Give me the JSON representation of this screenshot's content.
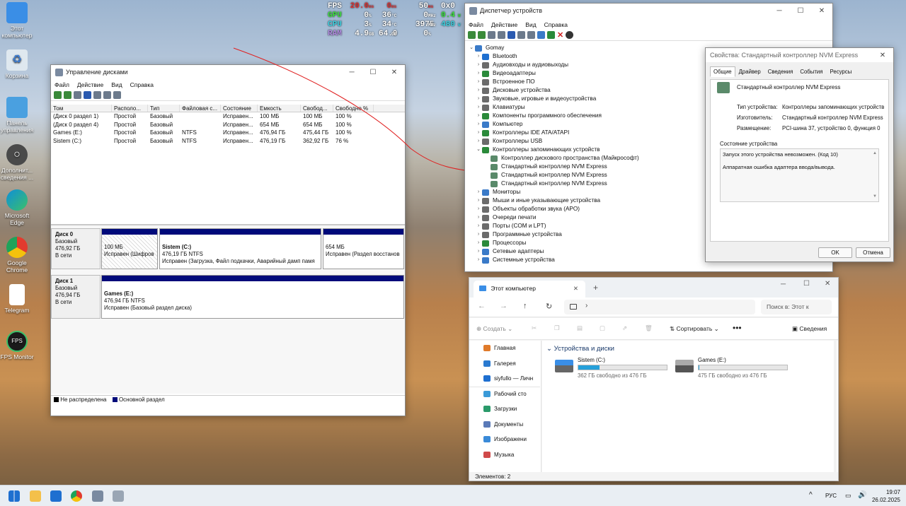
{
  "desktop": {
    "icons": [
      {
        "label": "Этот компьютер",
        "icon": "monitor-icon"
      },
      {
        "label": "Корзина",
        "icon": "recycle-bin-icon"
      },
      {
        "label": "Панель управления",
        "icon": "control-panel-icon"
      },
      {
        "label": "Дополнит... сведения ...",
        "icon": "settings-icon"
      },
      {
        "label": "Microsoft Edge",
        "icon": "edge-icon"
      },
      {
        "label": "Google Chrome",
        "icon": "chrome-icon"
      },
      {
        "label": "Telegram",
        "icon": "file-icon"
      },
      {
        "label": "FPS Monitor",
        "icon": "fps-monitor-icon"
      }
    ]
  },
  "overlay": {
    "fps": {
      "label": "FPS",
      "value": "20.0",
      "unit": "ms",
      "v2": "0",
      "u2": "ms",
      "v3": "50",
      "u3": "ms",
      "v4": "0x0"
    },
    "gpu": {
      "label": "GPU",
      "value": "0",
      "unit": "%",
      "v2": "36",
      "u2": "°C",
      "v3": "0",
      "u3": "MHz",
      "v4": "0.4",
      "u4": "W"
    },
    "cpu": {
      "label": "CPU",
      "value": "3",
      "unit": "%",
      "v2": "34",
      "u2": "°C",
      "v3": "3975",
      "u3": "MHz",
      "v4": "480",
      "u4": "W"
    },
    "ram": {
      "label": "RAM",
      "value": "4.9",
      "unit": "GB",
      "v2": "64.0",
      "u2": "GB",
      "v3": "0",
      "u3": "%"
    }
  },
  "disk_mgmt": {
    "title": "Управление дисками",
    "menu": [
      "Файл",
      "Действие",
      "Вид",
      "Справка"
    ],
    "columns": [
      "Том",
      "Располо...",
      "Тип",
      "Файловая с...",
      "Состояние",
      "Емкость",
      "Свобод...",
      "Свободно %"
    ],
    "rows": [
      [
        "(Диск 0 раздел 1)",
        "Простой",
        "Базовый",
        "",
        "Исправен...",
        "100 МБ",
        "100 МБ",
        "100 %"
      ],
      [
        "(Диск 0 раздел 4)",
        "Простой",
        "Базовый",
        "",
        "Исправен...",
        "654 МБ",
        "654 МБ",
        "100 %"
      ],
      [
        "Games (E:)",
        "Простой",
        "Базовый",
        "NTFS",
        "Исправен...",
        "476,94 ГБ",
        "475,44 ГБ",
        "100 %"
      ],
      [
        "Sistem (C:)",
        "Простой",
        "Базовый",
        "NTFS",
        "Исправен...",
        "476,19 ГБ",
        "362,92 ГБ",
        "76 %"
      ]
    ],
    "disk0": {
      "name": "Диск 0",
      "type": "Базовый",
      "size": "476,92 ГБ",
      "status": "В сети",
      "p1": {
        "size": "100 МБ",
        "status": "Исправен (Шифров"
      },
      "p2": {
        "name": "Sistem  (C:)",
        "size": "476,19 ГБ NTFS",
        "status": "Исправен (Загрузка, Файл подкачки, Аварийный дамп памя"
      },
      "p3": {
        "size": "654 МБ",
        "status": "Исправен (Раздел восстанов"
      }
    },
    "disk1": {
      "name": "Диск 1",
      "type": "Базовый",
      "size": "476,94 ГБ",
      "status": "В сети",
      "p1": {
        "name": "Games  (E:)",
        "size": "476,94 ГБ NTFS",
        "status": "Исправен (Базовый раздел диска)"
      }
    },
    "legend": {
      "unallocated": "Не распределена",
      "primary": "Основной раздел"
    }
  },
  "dev_mgr": {
    "title": "Диспетчер устройств",
    "menu": [
      "Файл",
      "Действие",
      "Вид",
      "Справка"
    ],
    "root": "Gomay",
    "items": [
      {
        "label": "Bluetooth",
        "color": "#1e6fd0"
      },
      {
        "label": "Аудиовходы и аудиовыходы",
        "color": "#6b6b6b"
      },
      {
        "label": "Видеоадаптеры",
        "color": "#2a8a3a"
      },
      {
        "label": "Встроенное ПО",
        "color": "#6b6b6b"
      },
      {
        "label": "Дисковые устройства",
        "color": "#6b6b6b"
      },
      {
        "label": "Звуковые, игровые и видеоустройства",
        "color": "#6b6b6b"
      },
      {
        "label": "Клавиатуры",
        "color": "#6b6b6b"
      },
      {
        "label": "Компоненты программного обеспечения",
        "color": "#2a8a3a"
      },
      {
        "label": "Компьютер",
        "color": "#3a7ac8"
      },
      {
        "label": "Контроллеры IDE ATA/ATAPI",
        "color": "#2a8a3a"
      },
      {
        "label": "Контроллеры USB",
        "color": "#6b6b6b"
      },
      {
        "label": "Контроллеры запоминающих устройств",
        "color": "#2a8a3a"
      }
    ],
    "storage_children": [
      "Контроллер дискового пространства (Майкрософт)",
      "Стандартный контроллер NVM Express",
      "Стандартный контроллер NVM Express",
      "Стандартный контроллер NVM Express"
    ],
    "items_after": [
      {
        "label": "Мониторы",
        "color": "#3a7ac8"
      },
      {
        "label": "Мыши и иные указывающие устройства",
        "color": "#6b6b6b"
      },
      {
        "label": "Объекты обработки звука (APO)",
        "color": "#6b6b6b"
      },
      {
        "label": "Очереди печати",
        "color": "#6b6b6b"
      },
      {
        "label": "Порты (COM и LPT)",
        "color": "#6b6b6b"
      },
      {
        "label": "Программные устройства",
        "color": "#6b6b6b"
      },
      {
        "label": "Процессоры",
        "color": "#2a8a3a"
      },
      {
        "label": "Сетевые адаптеры",
        "color": "#3a7ac8"
      },
      {
        "label": "Системные устройства",
        "color": "#3a7ac8"
      }
    ]
  },
  "props": {
    "title": "Свойства: Стандартный контроллер NVM Express",
    "tabs": [
      "Общие",
      "Драйвер",
      "Сведения",
      "События",
      "Ресурсы"
    ],
    "device_name": "Стандартный контроллер NVM Express",
    "type_label": "Тип устройства:",
    "type_value": "Контроллеры запоминающих устройств",
    "mfr_label": "Изготовитель:",
    "mfr_value": "Стандартный контроллер NVM Express",
    "loc_label": "Размещение:",
    "loc_value": "PCI-шина 37, устройство 0, функция 0",
    "status_group": "Состояние устройства",
    "status_line1": "Запуск этого устройства невозможен. (Код 10)",
    "status_line2": "Аппаратная ошибка адаптера ввода/вывода.",
    "ok": "OK",
    "cancel": "Отмена"
  },
  "explorer": {
    "tab_title": "Этот компьютер",
    "search_placeholder": "Поиск в: Этот к",
    "create": "Создать",
    "sort": "Сортировать",
    "details": "Сведения",
    "nav": [
      {
        "label": "Главная",
        "color": "#e07a2a"
      },
      {
        "label": "Галерея",
        "color": "#2a7ad0"
      },
      {
        "label": "siyfullo — Личн",
        "color": "#1e6fd0"
      },
      {
        "label": "Рабочий сто",
        "color": "#3a9ad8"
      },
      {
        "label": "Загрузки",
        "color": "#2a9a6a"
      },
      {
        "label": "Документы",
        "color": "#5a7ab8"
      },
      {
        "label": "Изображени",
        "color": "#3a8ad8"
      },
      {
        "label": "Музыка",
        "color": "#d04a4a"
      }
    ],
    "section": "Устройства и диски",
    "drives": [
      {
        "name": "Sistem (C:)",
        "free": "362 ГБ свободно из 476 ГБ",
        "used_fraction": 0.24
      },
      {
        "name": "Games (E:)",
        "free": "475 ГБ свободно из 476 ГБ",
        "used_fraction": 0.003
      }
    ],
    "status": "Элементов: 2"
  },
  "taskbar": {
    "lang": "РУС",
    "time": "19:07",
    "date": "26.02.2025"
  }
}
